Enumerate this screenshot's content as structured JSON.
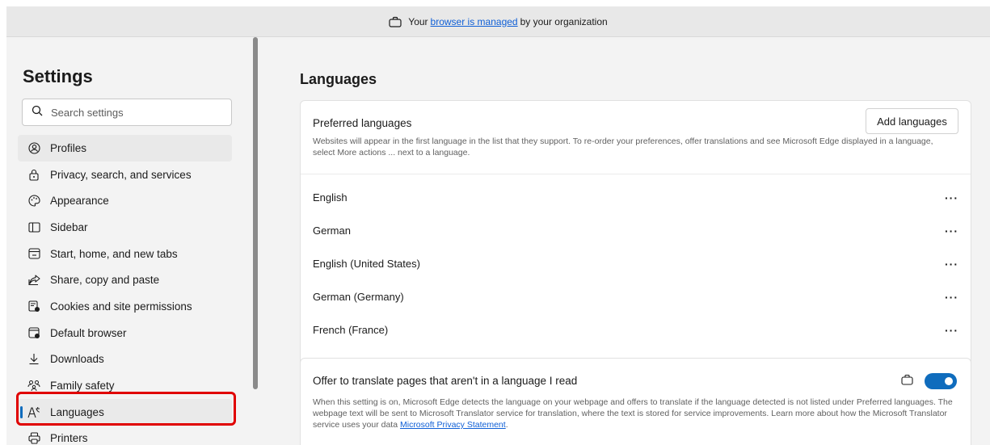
{
  "banner": {
    "prefix": "Your",
    "link": "browser is managed",
    "suffix": "by your organization"
  },
  "sidebar": {
    "title": "Settings",
    "search_placeholder": "Search settings",
    "items": [
      {
        "label": "Profiles",
        "icon": "profile-icon"
      },
      {
        "label": "Privacy, search, and services",
        "icon": "lock-icon"
      },
      {
        "label": "Appearance",
        "icon": "palette-icon"
      },
      {
        "label": "Sidebar",
        "icon": "sidebar-icon"
      },
      {
        "label": "Start, home, and new tabs",
        "icon": "home-tab-icon"
      },
      {
        "label": "Share, copy and paste",
        "icon": "share-icon"
      },
      {
        "label": "Cookies and site permissions",
        "icon": "cookies-icon"
      },
      {
        "label": "Default browser",
        "icon": "browser-icon"
      },
      {
        "label": "Downloads",
        "icon": "download-icon"
      },
      {
        "label": "Family safety",
        "icon": "family-icon"
      },
      {
        "label": "Languages",
        "icon": "languages-icon"
      },
      {
        "label": "Printers",
        "icon": "printer-icon"
      }
    ],
    "selected_item": "Languages"
  },
  "main": {
    "title": "Languages",
    "preferred": {
      "heading": "Preferred languages",
      "description": "Websites will appear in the first language in the list that they support. To re-order your preferences, offer translations and see Microsoft Edge displayed in a language, select More actions ... next to a language.",
      "add_button": "Add languages",
      "languages": [
        "English",
        "German",
        "English (United States)",
        "German (Germany)",
        "French (France)"
      ],
      "more_label": "···"
    },
    "translate": {
      "heading": "Offer to translate pages that aren't in a language I read",
      "description": "When this setting is on, Microsoft Edge detects the language on your webpage and offers to translate if the language detected is not listed under Preferred languages. The webpage text will be sent to Microsoft Translator service for translation, where the text is stored for service improvements. Learn more about how the Microsoft Translator service uses your data",
      "link": "Microsoft Privacy Statement",
      "link_suffix": ".",
      "toggle_on": true
    }
  },
  "colors": {
    "accent": "#0f6cbd",
    "highlight": "#e00000",
    "link": "#0f5fd6"
  }
}
